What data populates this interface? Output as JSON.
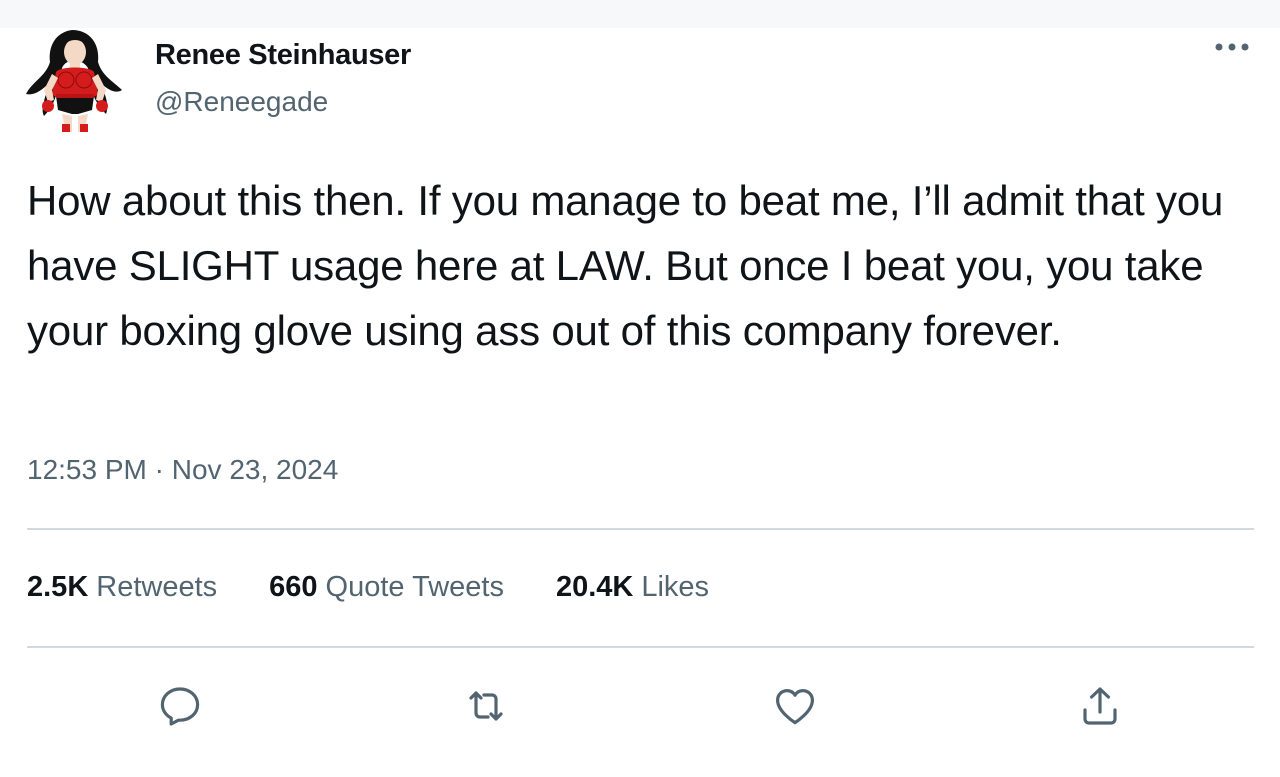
{
  "author": {
    "display_name": "Renee Steinhauser",
    "handle": "@Reneegade",
    "avatar_icon": "anime-character-avatar"
  },
  "tweet": {
    "text": "How about this then. If you manage to beat me, I’ll admit that you have SLIGHT usage here at LAW. But once I beat you, you take your boxing glove using ass out of this company forever.",
    "time": "12:53 PM",
    "separator": "·",
    "date": "Nov 23, 2024"
  },
  "stats": {
    "retweets_count": "2.5K",
    "retweets_label": "Retweets",
    "quotes_count": "660",
    "quotes_label": "Quote Tweets",
    "likes_count": "20.4K",
    "likes_label": "Likes"
  },
  "actions": [
    "reply-icon",
    "retweet-icon",
    "like-icon",
    "share-icon"
  ],
  "colors": {
    "text_primary": "#0f1419",
    "text_secondary": "#536471",
    "divider": "#cfd9de",
    "icon": "#536471"
  }
}
